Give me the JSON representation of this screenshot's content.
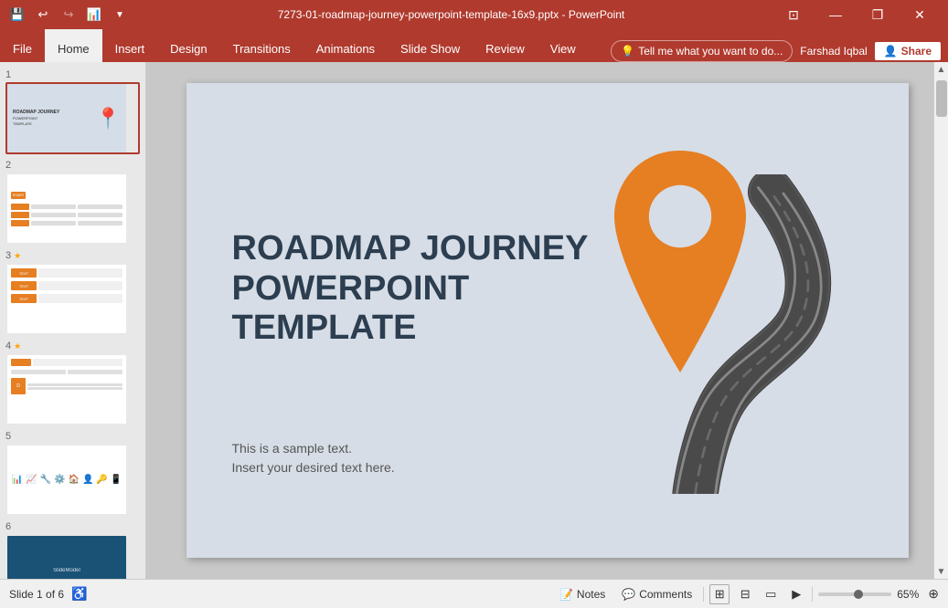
{
  "titlebar": {
    "title": "7273-01-roadmap-journey-powerpoint-template-16x9.pptx - PowerPoint",
    "controls": {
      "minimize": "—",
      "restore": "❐",
      "close": "✕"
    }
  },
  "quickaccess": {
    "save": "💾",
    "undo": "↩",
    "redo": "↪",
    "present": "📊"
  },
  "ribbon": {
    "tabs": [
      "File",
      "Home",
      "Insert",
      "Design",
      "Transitions",
      "Animations",
      "Slide Show",
      "Review",
      "View"
    ],
    "active": "Home",
    "tell_me": "Tell me what you want to do...",
    "user": "Farshad Iqbal",
    "share": "Share"
  },
  "slides": [
    {
      "num": "1",
      "star": false
    },
    {
      "num": "2",
      "star": false
    },
    {
      "num": "3",
      "star": true
    },
    {
      "num": "4",
      "star": true
    },
    {
      "num": "5",
      "star": false
    },
    {
      "num": "6",
      "star": false
    }
  ],
  "current_slide": {
    "title_line1": "ROADMAP JOURNEY",
    "title_line2": "POWERPOINT",
    "title_line3": "TEMPLATE",
    "body_line1": "This is a sample text.",
    "body_line2": "Insert your desired text here."
  },
  "statusbar": {
    "slide_info": "Slide 1 of 6",
    "notes": "Notes",
    "comments": "Comments",
    "zoom_percent": "65%"
  }
}
